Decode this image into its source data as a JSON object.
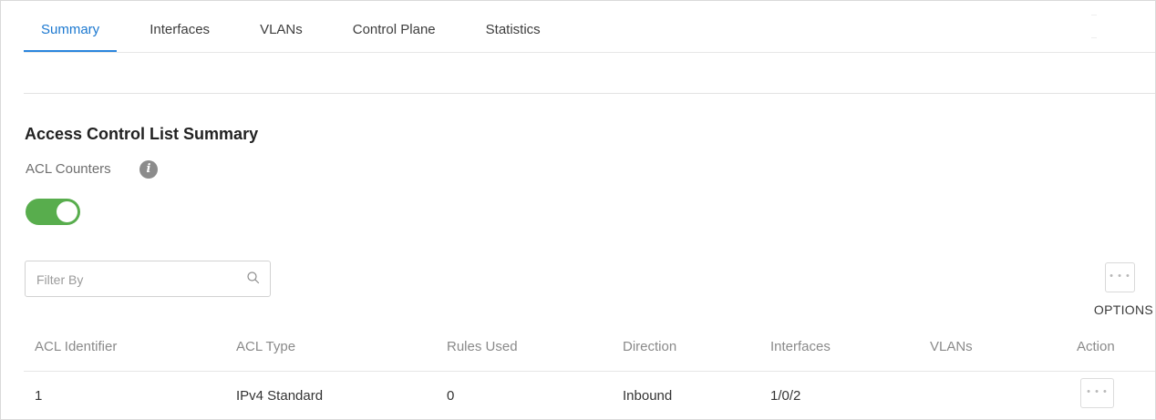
{
  "tabs": [
    {
      "label": "Summary",
      "active": true
    },
    {
      "label": "Interfaces",
      "active": false
    },
    {
      "label": "VLANs",
      "active": false
    },
    {
      "label": "Control Plane",
      "active": false
    },
    {
      "label": "Statistics",
      "active": false
    }
  ],
  "section": {
    "title": "Access Control List Summary",
    "counters_label": "ACL Counters",
    "info_icon": "info-icon",
    "counters_enabled": true
  },
  "filter": {
    "placeholder": "Filter By",
    "value": "",
    "icon": "search-icon"
  },
  "options": {
    "button_glyph": "• • •",
    "label": "OPTIONS"
  },
  "table": {
    "columns": [
      "ACL Identifier",
      "ACL Type",
      "Rules Used",
      "Direction",
      "Interfaces",
      "VLANs",
      "Action"
    ],
    "rows": [
      {
        "acl_identifier": "1",
        "acl_type": "IPv4 Standard",
        "rules_used": "0",
        "direction": "Inbound",
        "interfaces": "1/0/2",
        "vlans": "",
        "action_glyph": "• • •"
      }
    ]
  },
  "colors": {
    "accent": "#2a85dd",
    "toggle_on": "#58ad4d"
  }
}
